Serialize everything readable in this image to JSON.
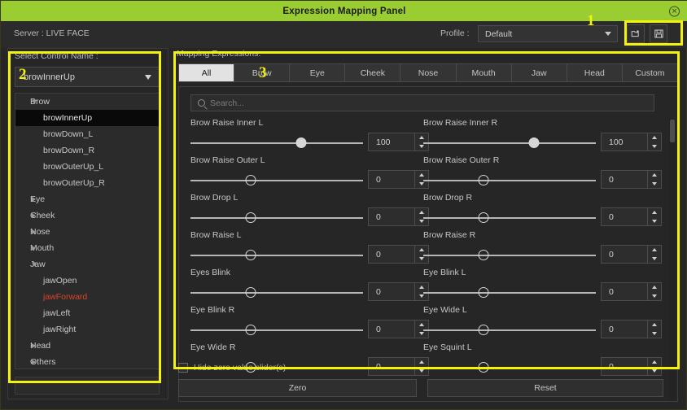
{
  "window": {
    "title": "Expression Mapping Panel",
    "close_icon": "close-icon",
    "titlebar_color": "#9acd32"
  },
  "topbar": {
    "server_text": "Server : LIVE FACE",
    "profile_label": "Profile :",
    "profile_value": "Default",
    "load_icon": "folder-load-icon",
    "save_icon": "floppy-save-icon"
  },
  "left_panel": {
    "label": "Select Control Name :",
    "dropdown_value": "browInnerUp",
    "tree": [
      {
        "label": "Brow",
        "type": "group",
        "expanded": true
      },
      {
        "label": "browInnerUp",
        "type": "child",
        "selected": true
      },
      {
        "label": "browDown_L",
        "type": "child"
      },
      {
        "label": "browDown_R",
        "type": "child"
      },
      {
        "label": "browOuterUp_L",
        "type": "child"
      },
      {
        "label": "browOuterUp_R",
        "type": "child"
      },
      {
        "label": "Eye",
        "type": "group",
        "expanded": false
      },
      {
        "label": "Cheek",
        "type": "group",
        "expanded": false
      },
      {
        "label": "Nose",
        "type": "group",
        "expanded": false
      },
      {
        "label": "Mouth",
        "type": "group",
        "expanded": false
      },
      {
        "label": "Jaw",
        "type": "group",
        "expanded": true
      },
      {
        "label": "jawOpen",
        "type": "child"
      },
      {
        "label": "jawForward",
        "type": "child",
        "flagged": true
      },
      {
        "label": "jawLeft",
        "type": "child"
      },
      {
        "label": "jawRight",
        "type": "child"
      },
      {
        "label": "Head",
        "type": "group",
        "expanded": false
      },
      {
        "label": "Others",
        "type": "group",
        "expanded": false
      }
    ]
  },
  "right_panel": {
    "label": "Mapping Expressions:",
    "tabs": [
      {
        "label": "All",
        "active": true
      },
      {
        "label": "Brow",
        "active": false
      },
      {
        "label": "Eye",
        "active": false
      },
      {
        "label": "Cheek",
        "active": false
      },
      {
        "label": "Nose",
        "active": false
      },
      {
        "label": "Mouth",
        "active": false
      },
      {
        "label": "Jaw",
        "active": false
      },
      {
        "label": "Head",
        "active": false
      },
      {
        "label": "Custom",
        "active": false
      }
    ],
    "search_placeholder": "Search...",
    "search_value": "",
    "search_icon": "search-icon",
    "sliders": [
      {
        "label": "Brow Raise Inner L",
        "value": "100",
        "pct": 64
      },
      {
        "label": "Brow Raise Inner R",
        "value": "100",
        "pct": 64
      },
      {
        "label": "Brow Raise Outer L",
        "value": "0",
        "pct": 35
      },
      {
        "label": "Brow Raise Outer R",
        "value": "0",
        "pct": 35
      },
      {
        "label": "Brow Drop L",
        "value": "0",
        "pct": 35
      },
      {
        "label": "Brow Drop R",
        "value": "0",
        "pct": 35
      },
      {
        "label": "Brow Raise L",
        "value": "0",
        "pct": 35
      },
      {
        "label": "Brow Raise R",
        "value": "0",
        "pct": 35
      },
      {
        "label": "Eyes Blink",
        "value": "0",
        "pct": 35
      },
      {
        "label": "Eye Blink L",
        "value": "0",
        "pct": 35
      },
      {
        "label": "Eye Blink R",
        "value": "0",
        "pct": 35
      },
      {
        "label": "Eye Wide L",
        "value": "0",
        "pct": 35
      },
      {
        "label": "Eye Wide R",
        "value": "0",
        "pct": 35
      },
      {
        "label": "Eye Squint L",
        "value": "0",
        "pct": 35
      }
    ],
    "scrollbar": "vertical-scrollbar"
  },
  "bottom": {
    "hide_zero_label": "Hide zero value slider(s)",
    "hide_zero_checked": false,
    "zero_label": "Zero",
    "reset_label": "Reset"
  },
  "annotations": [
    {
      "number": "1",
      "target": "profile-io-buttons"
    },
    {
      "number": "2",
      "target": "select-control-name-panel"
    },
    {
      "number": "3",
      "target": "mapping-expressions-panel"
    }
  ]
}
